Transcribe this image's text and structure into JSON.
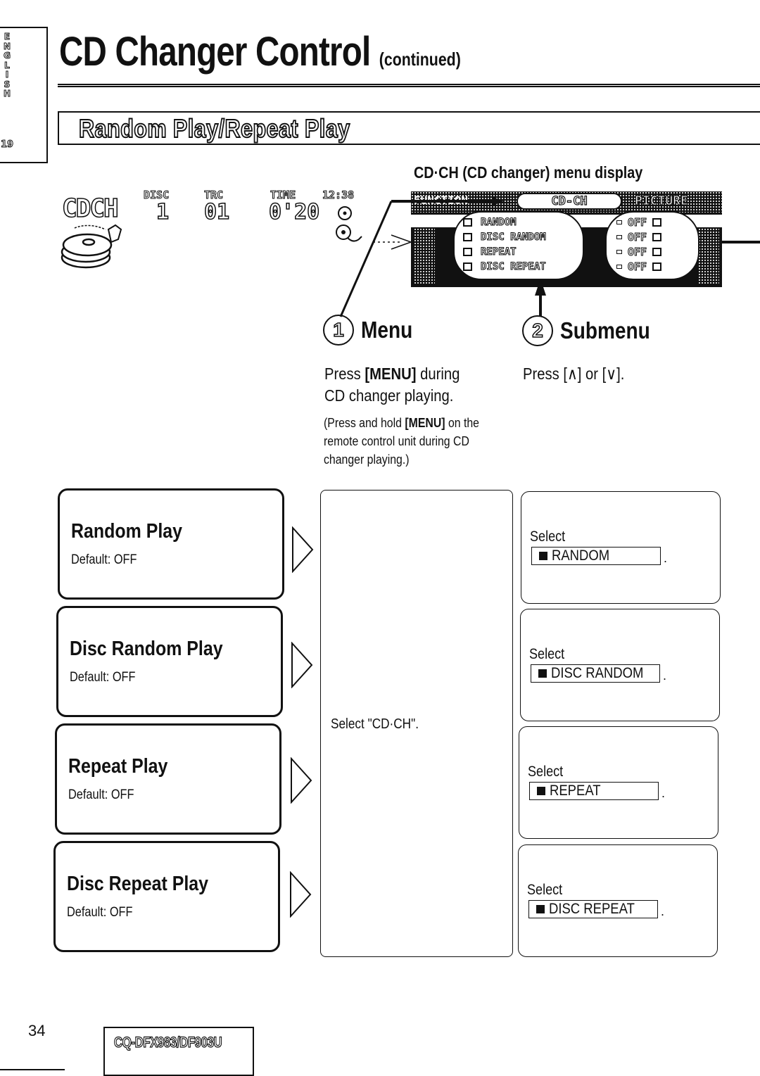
{
  "side_tab": {
    "language_letters": [
      "E",
      "N",
      "G",
      "L",
      "I",
      "S",
      "H"
    ],
    "section_number": "19"
  },
  "header": {
    "title": "CD Changer Control",
    "title_suffix": "(continued)",
    "section_title": "Random Play/Repeat Play"
  },
  "status_display": {
    "source": "CDCH",
    "disc_label": "DISC",
    "disc_value": "1",
    "track_label": "TRC",
    "track_value": "01",
    "time_label": "TIME",
    "time_value": "0'20",
    "clock": "12:38"
  },
  "menu_display": {
    "caption": "CD·CH (CD changer) menu display",
    "tabs": [
      {
        "label": "FUNCTION",
        "active": false
      },
      {
        "label": "CD-CH",
        "active": true
      },
      {
        "label": "PICTURE",
        "active": false
      }
    ],
    "items": [
      {
        "label": "RANDOM",
        "value": "OFF"
      },
      {
        "label": "DISC RANDOM",
        "value": "OFF"
      },
      {
        "label": "REPEAT",
        "value": "OFF"
      },
      {
        "label": "DISC REPEAT",
        "value": "OFF"
      }
    ]
  },
  "steps": [
    {
      "number": "1",
      "title": "Menu",
      "text_pre": "Press ",
      "text_key": "[MENU]",
      "text_post": " during",
      "text_line2": "CD changer playing.",
      "note_pre": "(Press and hold ",
      "note_key": "[MENU]",
      "note_post": " on the",
      "note_line2": "remote control unit during CD",
      "note_line3": "changer playing.)"
    },
    {
      "number": "2",
      "title": "Submenu",
      "text": "Press [∧] or [∨]."
    }
  ],
  "features": [
    {
      "title": "Random Play",
      "default": "Default: OFF",
      "select_label": "Select",
      "select_value": "RANDOM"
    },
    {
      "title": "Disc Random Play",
      "default": "Default: OFF",
      "select_label": "Select",
      "select_value": "DISC RANDOM"
    },
    {
      "title": "Repeat Play",
      "default": "Default: OFF",
      "select_label": "Select",
      "select_value": "REPEAT"
    },
    {
      "title": "Disc Repeat Play",
      "default": "Default: OFF",
      "select_label": "Select",
      "select_value": "DISC REPEAT"
    }
  ],
  "menu_column_text": "Select \"CD·CH\".",
  "footer": {
    "page_number": "34",
    "model": "CQ-DFX983/DF903U"
  }
}
